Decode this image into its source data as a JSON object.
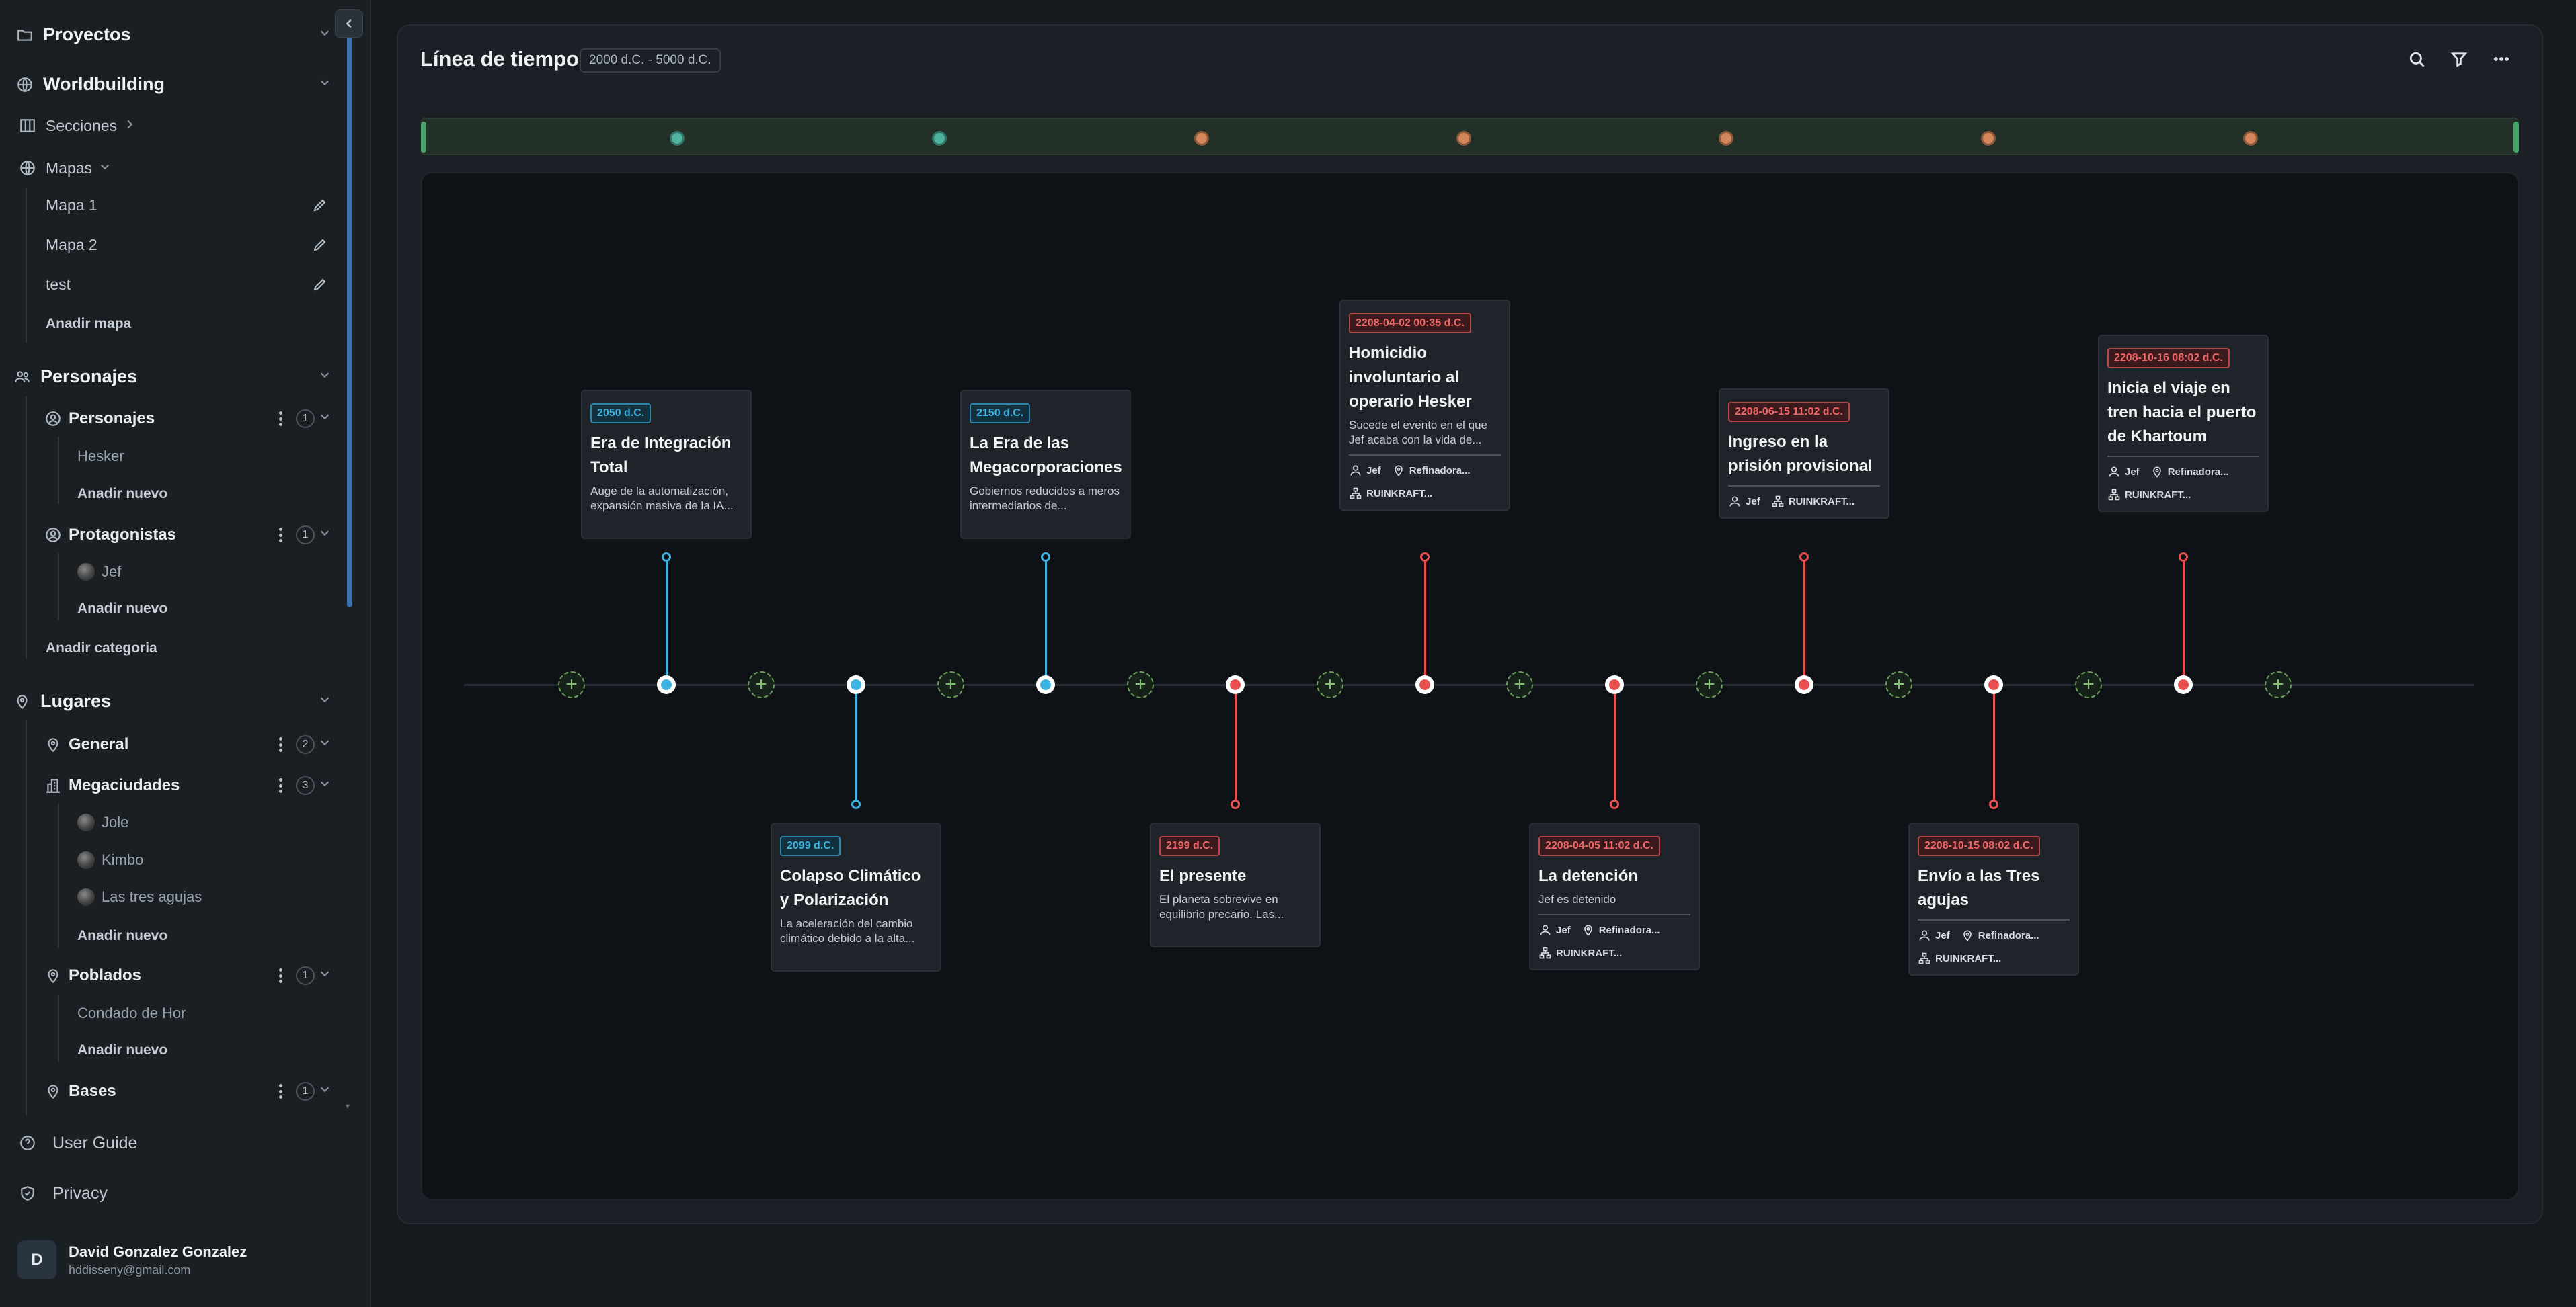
{
  "sidebar": {
    "proyectos": "Proyectos",
    "worldbuilding": "Worldbuilding",
    "secciones": "Secciones",
    "mapas": "Mapas",
    "mapas_items": [
      "Mapa 1",
      "Mapa 2",
      "test"
    ],
    "anadir_mapa": "Anadir mapa",
    "personajes_section": "Personajes",
    "personajes_group": {
      "label": "Personajes",
      "count": "1",
      "items": [
        "Hesker"
      ],
      "add": "Anadir nuevo"
    },
    "protagonistas_group": {
      "label": "Protagonistas",
      "count": "1",
      "items": [
        "Jef"
      ],
      "add": "Anadir nuevo"
    },
    "anadir_categoria": "Anadir categoria",
    "lugares_section": "Lugares",
    "general_group": {
      "label": "General",
      "count": "2"
    },
    "megaciudades_group": {
      "label": "Megaciudades",
      "count": "3",
      "items": [
        "Jole",
        "Kimbo",
        "Las tres agujas"
      ],
      "add": "Anadir nuevo"
    },
    "poblados_group": {
      "label": "Poblados",
      "count": "1",
      "items": [
        "Condado de Hor"
      ],
      "add": "Anadir nuevo"
    },
    "bases_group": {
      "label": "Bases",
      "count": "1"
    },
    "user_guide": "User Guide",
    "privacy": "Privacy",
    "user": {
      "initial": "D",
      "name": "David Gonzalez Gonzalez",
      "email": "hddisseny@gmail.com"
    }
  },
  "header": {
    "title": "Línea de tiempo",
    "range": "2000 d.C. - 5000 d.C."
  },
  "colors": {
    "blue": "#3cb3e0",
    "red": "#e8504f",
    "green": "#6aa05a"
  },
  "minimap_dots": [
    "teal",
    "teal",
    "orange",
    "orange",
    "orange",
    "orange",
    "orange"
  ],
  "events": [
    {
      "date": "2050 d.C.",
      "title": "Era de Integración Total",
      "desc": "Auge de la automatización, expansión masiva de la IA...",
      "color": "blue",
      "pos": "top"
    },
    {
      "date": "2099 d.C.",
      "title": "Colapso Climático y Polarización",
      "desc": "La aceleración del cambio climático debido a la alta...",
      "color": "blue",
      "pos": "bottom"
    },
    {
      "date": "2150 d.C.",
      "title": "La Era de las Megacorporaciones",
      "desc": "Gobiernos reducidos a meros intermediarios de...",
      "color": "blue",
      "pos": "top"
    },
    {
      "date": "2199 d.C.",
      "title": "El presente",
      "desc": "El planeta sobrevive en equilibrio precario. Las...",
      "color": "red",
      "pos": "bottom"
    },
    {
      "date": "2208-04-02 00:35 d.C.",
      "title": "Homicidio involuntario al operario Hesker",
      "desc": "Sucede el evento en el que Jef acaba con la vida de...",
      "color": "red",
      "pos": "top",
      "tags": [
        "Jef",
        "Refinadora...",
        "RUINKRAFT..."
      ]
    },
    {
      "date": "2208-04-05 11:02 d.C.",
      "title": "La detención",
      "desc": "Jef es detenido",
      "color": "red",
      "pos": "bottom",
      "tags": [
        "Jef",
        "Refinadora...",
        "RUINKRAFT..."
      ]
    },
    {
      "date": "2208-06-15 11:02 d.C.",
      "title": "Ingreso en la prisión provisional",
      "desc": "",
      "color": "red",
      "pos": "top",
      "tags": [
        "Jef",
        "RUINKRAFT..."
      ]
    },
    {
      "date": "2208-10-15 08:02 d.C.",
      "title": "Envío a las Tres agujas",
      "desc": "",
      "color": "red",
      "pos": "bottom",
      "tags": [
        "Jef",
        "Refinadora...",
        "RUINKRAFT..."
      ]
    },
    {
      "date": "2208-10-16 08:02 d.C.",
      "title": "Inicia el viaje en tren hacia el puerto de Khartoum",
      "desc": "",
      "color": "red",
      "pos": "top",
      "tags": [
        "Jef",
        "Refinadora...",
        "RUINKRAFT..."
      ]
    }
  ]
}
